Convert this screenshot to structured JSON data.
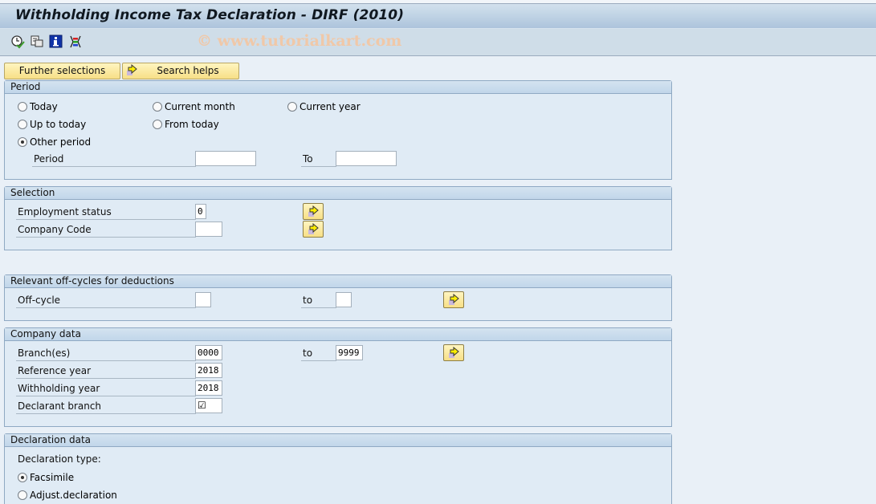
{
  "window": {
    "title": "Withholding Income Tax Declaration - DIRF (2010)"
  },
  "toolbar": {
    "icons": [
      "execute-clock-icon",
      "get-variant-icon",
      "information-icon",
      "selection-options-icon"
    ],
    "watermark": "© www.tutorialkart.com"
  },
  "buttons": {
    "further_selections": "Further selections",
    "search_helps": "Search helps"
  },
  "period": {
    "title": "Period",
    "options": [
      {
        "label": "Today",
        "selected": false
      },
      {
        "label": "Current month",
        "selected": false
      },
      {
        "label": "Current year",
        "selected": false
      },
      {
        "label": "Up to today",
        "selected": false
      },
      {
        "label": "From today",
        "selected": false
      },
      {
        "label": "Other period",
        "selected": true
      }
    ],
    "period_label": "Period",
    "period_from": "",
    "to_label": "To",
    "period_to": ""
  },
  "selection": {
    "title": "Selection",
    "employment_status_label": "Employment status",
    "employment_status_value": "0",
    "company_code_label": "Company Code",
    "company_code_value": ""
  },
  "offcycles": {
    "title": "Relevant off-cycles for deductions",
    "offcycle_label": "Off-cycle",
    "offcycle_from": "",
    "to_label": "to",
    "offcycle_to": ""
  },
  "company_data": {
    "title": "Company data",
    "branches_label": "Branch(es)",
    "branches_from": "0000",
    "to_label": "to",
    "branches_to": "9999",
    "reference_year_label": "Reference year",
    "reference_year_value": "2018",
    "withholding_year_label": "Withholding year",
    "withholding_year_value": "2018",
    "declarant_branch_label": "Declarant branch",
    "declarant_branch_checked": true,
    "declarant_branch_glyph": "☑"
  },
  "declaration_data": {
    "title": "Declaration data",
    "type_label": "Declaration type:",
    "options": [
      {
        "label": "Facsimile",
        "selected": true
      },
      {
        "label": "Adjust.declaration",
        "selected": false
      }
    ]
  }
}
